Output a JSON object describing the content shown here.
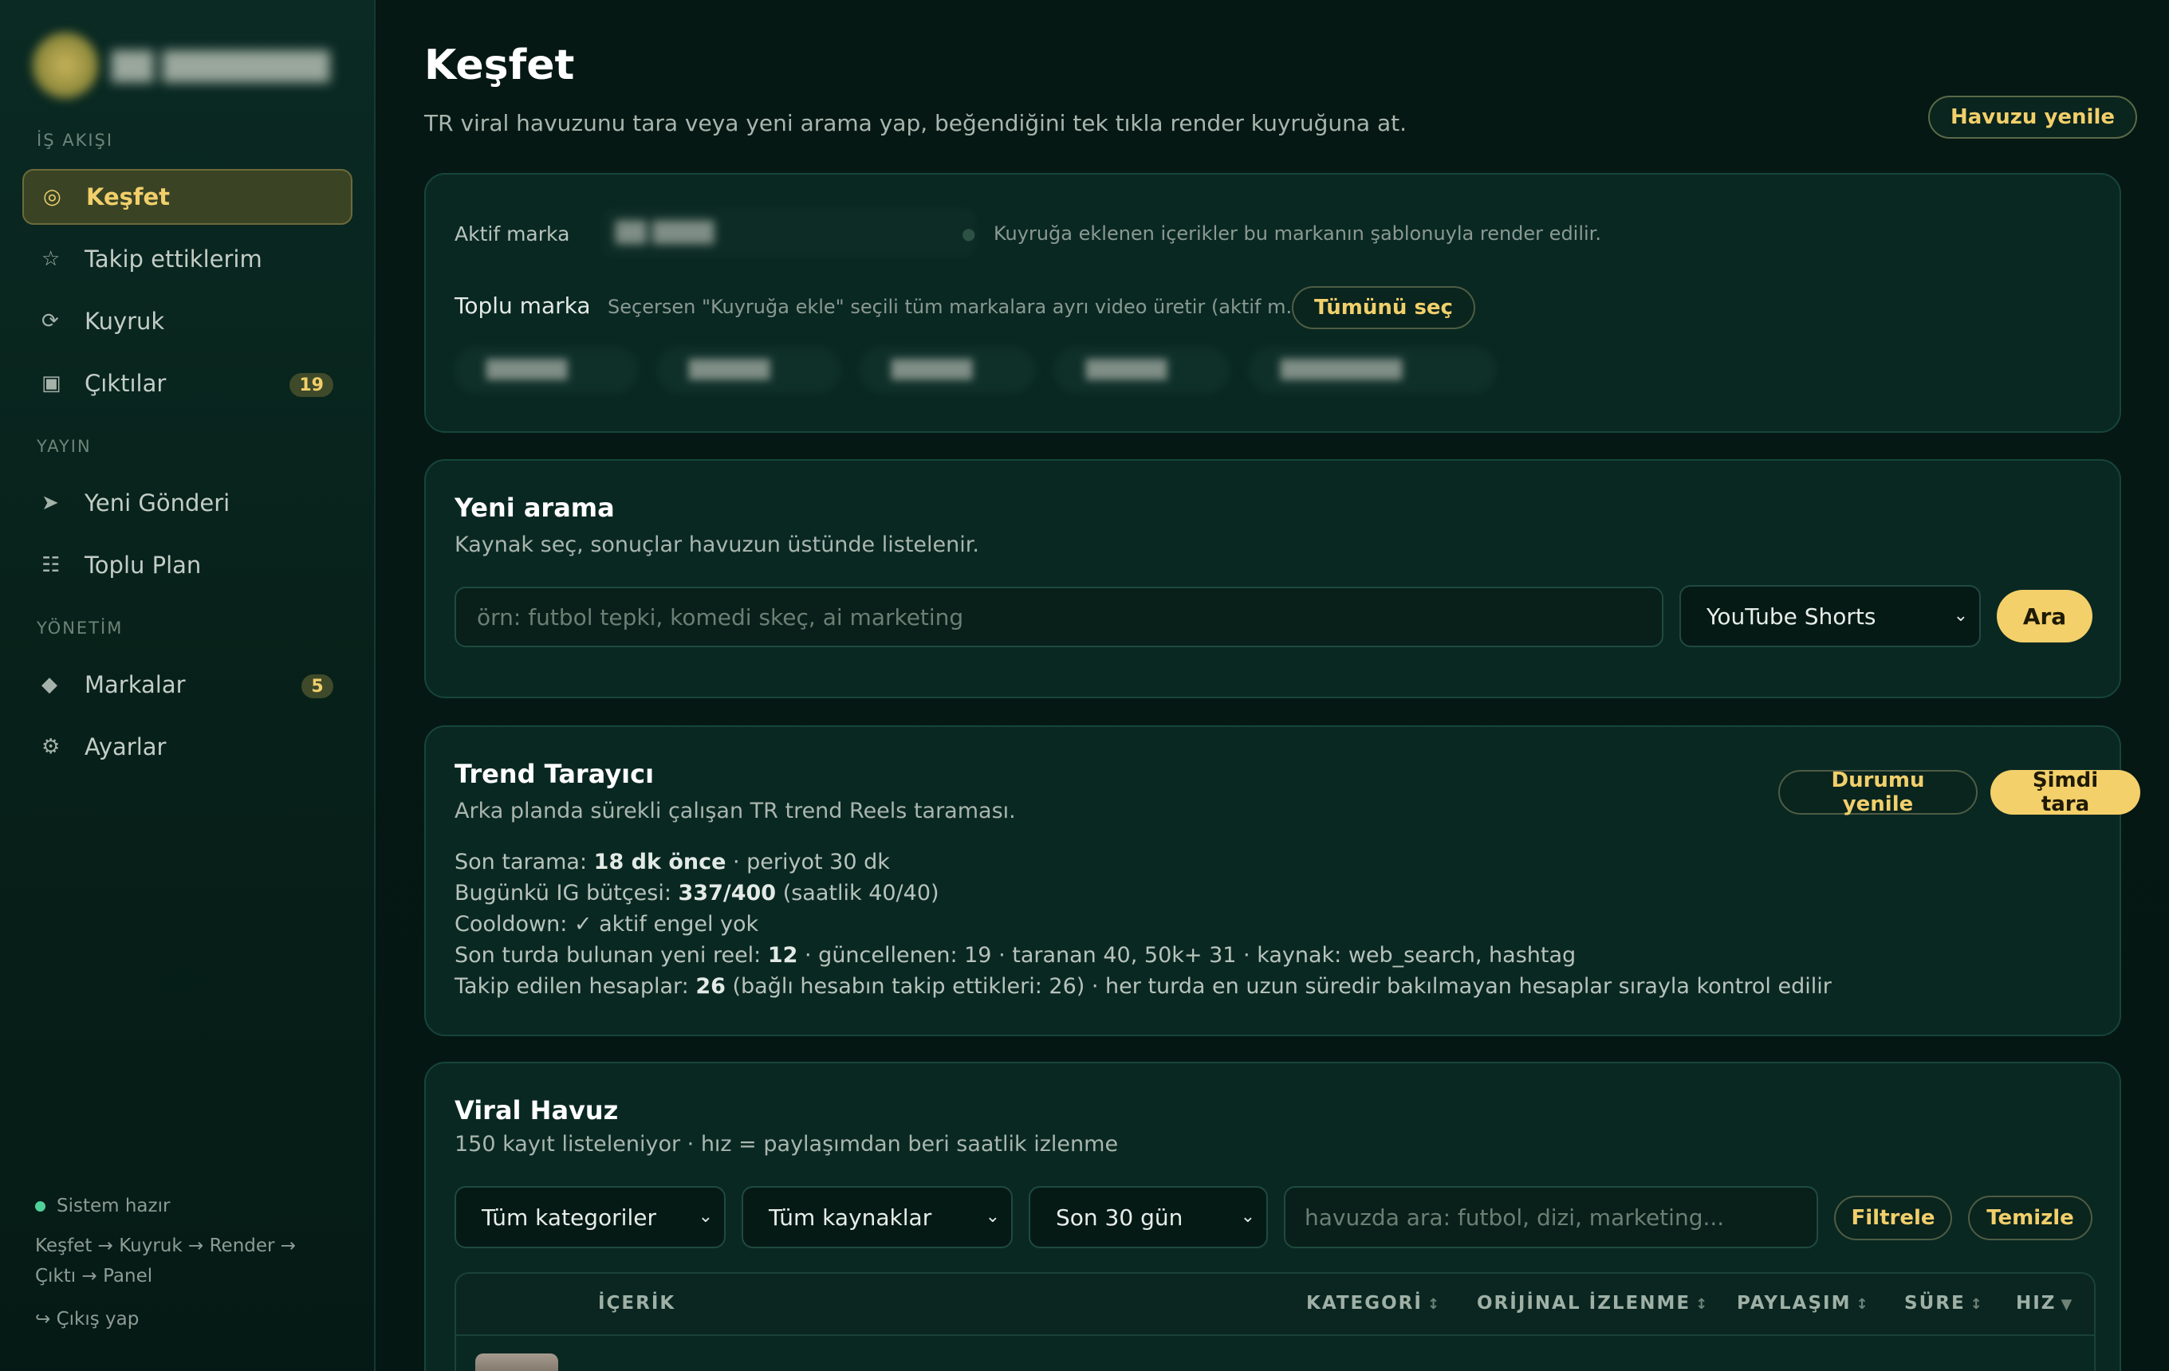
{
  "sidebar": {
    "sections": [
      "İŞ AKIŞI",
      "YAYIN",
      "YÖNETİM"
    ],
    "items": [
      {
        "label": "Keşfet",
        "icon": "◎"
      },
      {
        "label": "Takip ettiklerim",
        "icon": "☆"
      },
      {
        "label": "Kuyruk",
        "icon": "⟳"
      },
      {
        "label": "Çıktılar",
        "icon": "▣",
        "badge": "19"
      },
      {
        "label": "Yeni Gönderi",
        "icon": "➤"
      },
      {
        "label": "Toplu Plan",
        "icon": "☷"
      },
      {
        "label": "Markalar",
        "icon": "◆",
        "badge": "5"
      },
      {
        "label": "Ayarlar",
        "icon": "⚙"
      }
    ],
    "status": "Sistem hazır",
    "flow": "Keşfet → Kuyruk → Render → Çıktı → Panel",
    "logout": "↪ Çıkış yap"
  },
  "header": {
    "title": "Keşfet",
    "subtitle": "TR viral havuzunu tara veya yeni arama yap, beğendiğini tek tıkla render kuyruğuna at.",
    "refresh_pool": "Havuzu yenile"
  },
  "brand_card": {
    "active_label": "Aktif marka",
    "active_hint": "Kuyruğa eklenen içerikler bu markanın şablonuyla render edilir.",
    "bulk_label": "Toplu marka",
    "bulk_hint": "Seçersen \"Kuyruğa ekle\" seçili tüm markalara ayrı video üretir (aktif m...",
    "select_all": "Tümünü seç"
  },
  "search_card": {
    "title": "Yeni arama",
    "subtitle": "Kaynak seç, sonuçlar havuzun üstünde listelenir.",
    "placeholder": "örn: futbol tepki, komedi skeç, ai marketing",
    "source": "YouTube Shorts",
    "button": "Ara"
  },
  "trend_card": {
    "title": "Trend Tarayıcı",
    "subtitle": "Arka planda sürekli çalışan TR trend Reels taraması.",
    "refresh_status": "Durumu yenile",
    "scan_now": "Şimdi tara",
    "lines": {
      "l1_pre": "Son tarama: ",
      "l1_bold": "18 dk önce",
      "l1_post": " · periyot 30 dk",
      "l2_pre": "Bugünkü IG bütçesi: ",
      "l2_bold": "337/400",
      "l2_post": " (saatlik 40/40)",
      "l3": "Cooldown: ✓ aktif engel yok",
      "l4_pre": "Son turda bulunan yeni reel: ",
      "l4_bold": "12",
      "l4_post": " · güncellenen: 19 · taranan 40, 50k+ 31 · kaynak: web_search, hashtag",
      "l5_pre": "Takip edilen hesaplar: ",
      "l5_bold": "26",
      "l5_post": " (bağlı hesabın takip ettikleri: 26) · her turda en uzun süredir bakılmayan hesaplar sırayla kontrol edilir"
    }
  },
  "pool_card": {
    "title": "Viral Havuz",
    "subtitle": "150 kayıt listeleniyor · hız = paylaşımdan beri saatlik izlenme",
    "filters": {
      "category": "Tüm kategoriler",
      "source": "Tüm kaynaklar",
      "period": "Son 30 gün",
      "search_placeholder": "havuzda ara: futbol, dizi, marketing...",
      "filter_button": "Filtrele",
      "clear_button": "Temizle"
    },
    "columns": [
      "İÇERİK",
      "KATEGORİ",
      "ORİJİNAL İZLENME",
      "PAYLAŞIM",
      "SÜRE",
      "HIZ"
    ],
    "sort_icons": [
      "↕",
      "↕",
      "↕",
      "↕",
      "▼"
    ]
  }
}
